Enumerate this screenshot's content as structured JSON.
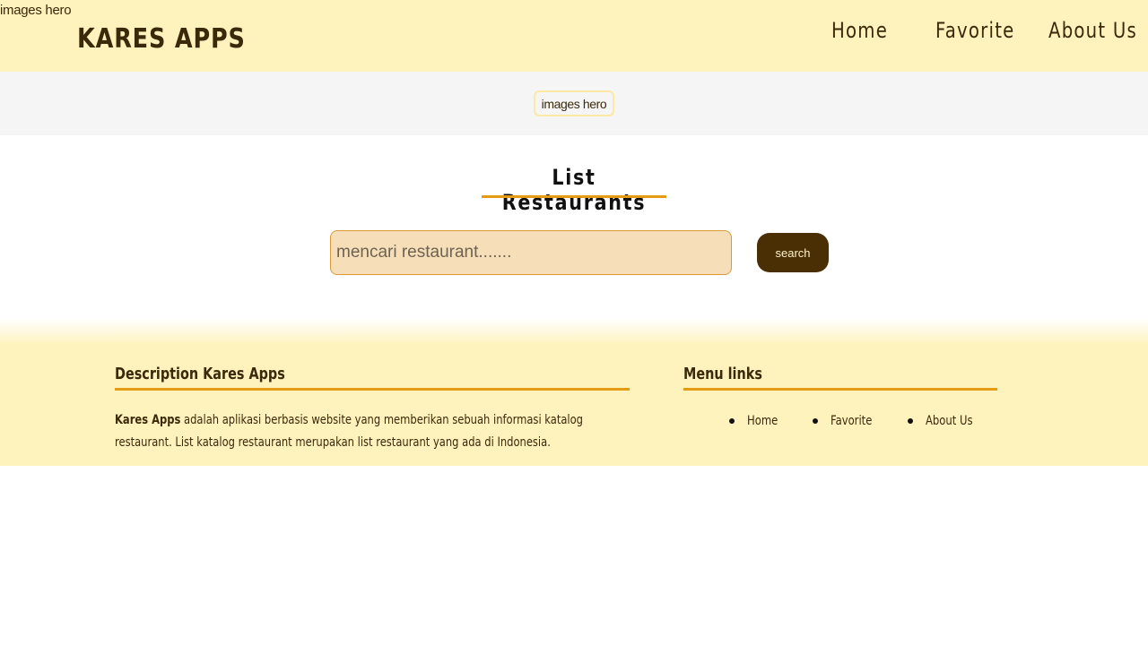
{
  "header": {
    "broken_image_alt": "images hero",
    "brand": "KARES APPS",
    "nav": [
      {
        "label": "Home"
      },
      {
        "label": "Favorite"
      },
      {
        "label": "About Us"
      }
    ]
  },
  "hero": {
    "image_alt": "images hero"
  },
  "main": {
    "title": "List Restaurants",
    "search_placeholder": "mencari restaurant.......",
    "search_button": "search"
  },
  "footer": {
    "description_heading": "Description Kares Apps",
    "description_brand": "Kares Apps",
    "description_text": " adalah aplikasi berbasis website yang memberikan sebuah informasi katalog restaurant. List katalog restaurant merupakan list restaurant yang ada di Indonesia.",
    "menu_heading": "Menu links",
    "menu_links": [
      {
        "label": "Home"
      },
      {
        "label": "Favorite"
      },
      {
        "label": "About Us"
      }
    ]
  },
  "colors": {
    "header_bg": "#fef2bd",
    "accent": "#e39c14",
    "button_bg": "#4a2f04",
    "input_bg": "#f6dfb8"
  }
}
